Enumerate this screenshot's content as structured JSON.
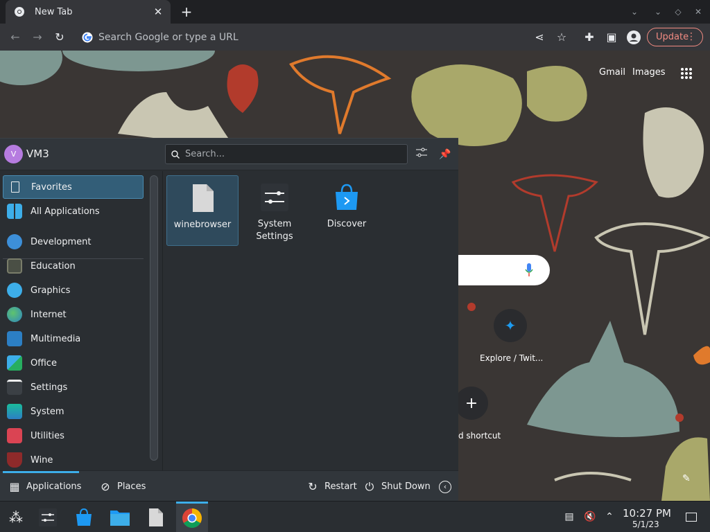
{
  "browser": {
    "tab_title": "New Tab",
    "omnibox_placeholder": "Search Google or type a URL",
    "update_label": "Update",
    "accent": "#f28b82"
  },
  "ntp": {
    "links": [
      "Gmail",
      "Images"
    ],
    "shortcuts": [
      {
        "label": "Explore / Twit..."
      },
      {
        "label": "d shortcut"
      }
    ]
  },
  "launcher": {
    "user": {
      "initial": "V",
      "name": "VM3"
    },
    "search_placeholder": "Search...",
    "categories": [
      {
        "label": "Favorites",
        "icon": "bookmark-icon"
      },
      {
        "label": "All Applications",
        "icon": "all-apps-icon"
      },
      {
        "label": "Development",
        "icon": "development-icon"
      },
      {
        "label": "Education",
        "icon": "education-icon"
      },
      {
        "label": "Graphics",
        "icon": "graphics-icon"
      },
      {
        "label": "Internet",
        "icon": "internet-icon"
      },
      {
        "label": "Multimedia",
        "icon": "multimedia-icon"
      },
      {
        "label": "Office",
        "icon": "office-icon"
      },
      {
        "label": "Settings",
        "icon": "settings-icon"
      },
      {
        "label": "System",
        "icon": "system-icon"
      },
      {
        "label": "Utilities",
        "icon": "utilities-icon"
      },
      {
        "label": "Wine",
        "icon": "wine-icon"
      }
    ],
    "favorites": [
      {
        "label": "winebrowser",
        "icon": "file-icon"
      },
      {
        "label": "System Settings",
        "icon": "system-settings-icon"
      },
      {
        "label": "Discover",
        "icon": "discover-icon"
      }
    ],
    "footer": {
      "applications": "Applications",
      "places": "Places",
      "restart": "Restart",
      "shutdown": "Shut Down"
    }
  },
  "panel": {
    "time": "10:27 PM",
    "date": "5/1/23",
    "tasks": [
      "kickoff-launcher-icon",
      "system-settings-icon",
      "discover-icon",
      "file-manager-icon",
      "file-icon",
      "chrome-icon"
    ]
  }
}
